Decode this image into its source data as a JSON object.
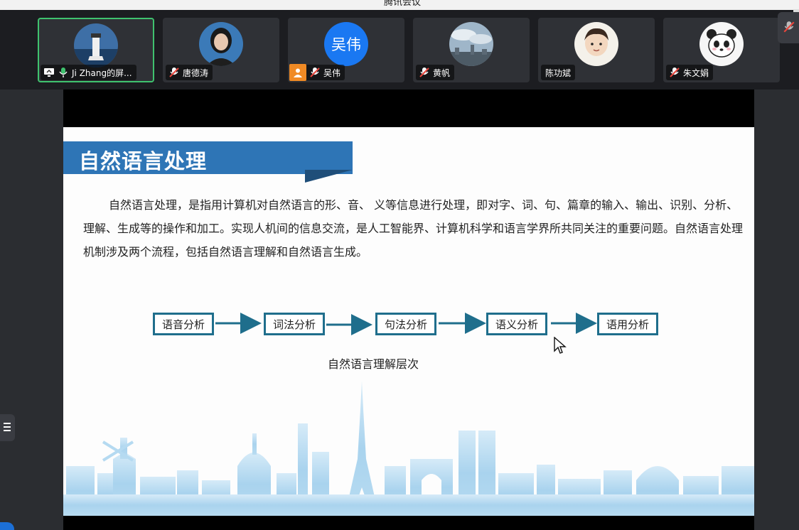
{
  "window": {
    "title": "腾讯会议"
  },
  "participants": [
    {
      "name": "Ji Zhang的屏...",
      "avatar": "lighthouse-photo",
      "mic": "on",
      "sharing": true,
      "active": true
    },
    {
      "name": "唐德涛",
      "avatar": "woman-photo",
      "mic": "muted"
    },
    {
      "name": "吴伟",
      "avatar_text": "吴伟",
      "avatar": "text-avatar",
      "mic": "muted",
      "host_badge": true
    },
    {
      "name": "黄帆",
      "avatar": "city-sky-photo",
      "mic": "muted"
    },
    {
      "name": "陈功斌",
      "avatar": "cartoon-boy",
      "mic": "none"
    },
    {
      "name": "朱文娟",
      "avatar": "panda-cartoon",
      "mic": "muted"
    }
  ],
  "slide": {
    "title": "自然语言处理",
    "paragraph": "自然语言处理，是指用计算机对自然语言的形、音、 义等信息进行处理，即对字、词、句、篇章的输入、输出、识别、分析、理解、生成等的操作和加工。实现人机间的信息交流，是人工智能界、计算机科学和语言学界所共同关注的重要问题。自然语言处理机制涉及两个流程，包括自然语言理解和自然语言生成。",
    "flow": [
      "语音分析",
      "词法分析",
      "句法分析",
      "语义分析",
      "语用分析"
    ],
    "flow_caption": "自然语言理解层次"
  },
  "colors": {
    "title_bar": "#2e75b6",
    "flow_border": "#1f6e8c",
    "skyline": "#a9d3ee",
    "active_tile": "#3fc26e",
    "avatar_blue": "#1a78f2"
  }
}
